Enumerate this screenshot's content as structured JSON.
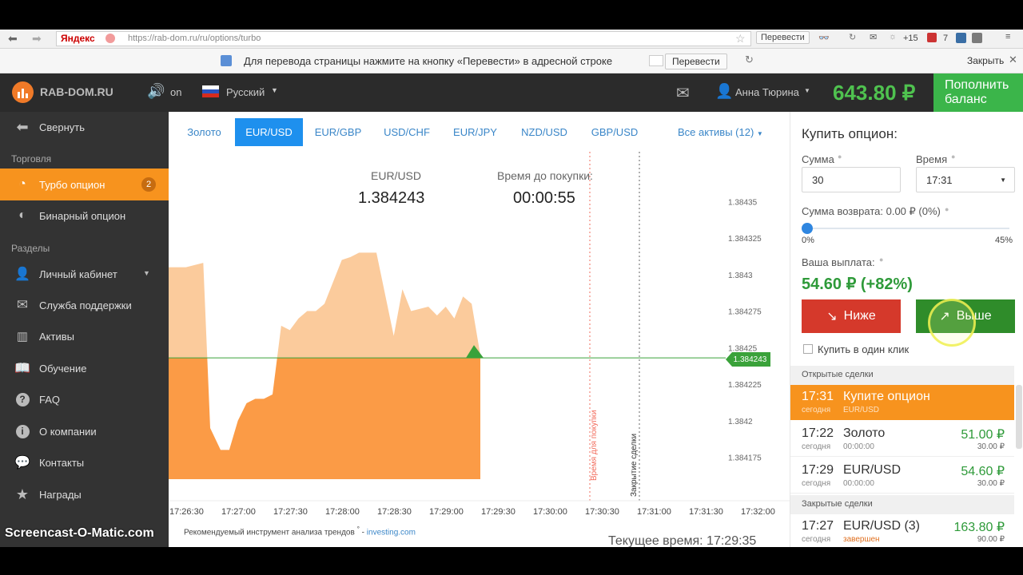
{
  "browser": {
    "yandex_logo": "Яндекс",
    "url": "https://rab-dom.ru/ru/options/turbo",
    "translate_button": "Перевести",
    "weather": "+15",
    "mail_count": "7"
  },
  "translate_bar": {
    "message": "Для перевода страницы нажмите на кнопку «Перевести» в адресной строке",
    "button": "Перевести",
    "close": "Закрыть"
  },
  "header": {
    "logo": "RAB-DOM.RU",
    "sound": "on",
    "language": "Русский",
    "user": "Анна Тюрина",
    "balance": "643.80 ₽",
    "deposit_line1": "Пополнить",
    "deposit_line2": "баланс"
  },
  "sidebar": {
    "collapse": "Свернуть",
    "section_trade": "Торговля",
    "turbo": "Турбо опцион",
    "turbo_badge": "2",
    "binary": "Бинарный опцион",
    "section_sections": "Разделы",
    "cabinet": "Личный кабинет",
    "support": "Служба поддержки",
    "assets": "Активы",
    "learning": "Обучение",
    "faq": "FAQ",
    "about": "О компании",
    "contacts": "Контакты",
    "rewards": "Награды"
  },
  "tabs": [
    "Золото",
    "EUR/USD",
    "EUR/GBP",
    "USD/CHF",
    "EUR/JPY",
    "NZD/USD",
    "GBP/USD"
  ],
  "tabs_all": "Все активы (12)",
  "chart": {
    "pair_label": "EUR/USD",
    "price": "1.384243",
    "time_label": "Время до покупки:",
    "countdown": "00:00:55",
    "current_price_tag": "1.384243",
    "y_labels": [
      "1.38435",
      "1.384325",
      "1.3843",
      "1.384275",
      "1.38425",
      "1.384225",
      "1.3842",
      "1.384175"
    ],
    "x_labels": [
      "17:26:30",
      "17:27:00",
      "17:27:30",
      "17:28:00",
      "17:28:30",
      "17:29:00",
      "17:29:30",
      "17:30:00",
      "17:30:30",
      "17:31:00",
      "17:31:30",
      "17:32:00"
    ],
    "buy_line_label": "Время для покупки",
    "close_line_label": "Закрытие сделки",
    "footnote": "Рекомендуемый инструмент анализа трендов",
    "footnote_link": "investing.com",
    "current_time_label": "Текущее время:",
    "current_time": "17:29:35",
    "colors": {
      "area_light": "#fbcb9c",
      "area_dark": "#fb9b46",
      "price_line": "#3aa23a"
    }
  },
  "chart_data": {
    "type": "area",
    "xlabel": "",
    "ylabel": "",
    "x": [
      "17:26:30",
      "17:26:40",
      "17:26:50",
      "17:26:54",
      "17:27:00",
      "17:27:05",
      "17:27:10",
      "17:27:15",
      "17:27:20",
      "17:27:25",
      "17:27:30",
      "17:27:35",
      "17:27:40",
      "17:27:45",
      "17:27:50",
      "17:27:55",
      "17:28:00",
      "17:28:10",
      "17:28:15",
      "17:28:20",
      "17:28:30",
      "17:28:40",
      "17:28:45",
      "17:28:50",
      "17:29:00",
      "17:29:05",
      "17:29:10",
      "17:29:15",
      "17:29:20",
      "17:29:25",
      "17:29:30"
    ],
    "values": [
      1.384305,
      1.384305,
      1.384308,
      1.384195,
      1.38418,
      1.38418,
      1.3842,
      1.384212,
      1.384215,
      1.384215,
      1.384218,
      1.384265,
      1.384262,
      1.38427,
      1.384275,
      1.384275,
      1.38428,
      1.38431,
      1.384312,
      1.384315,
      1.384315,
      1.384258,
      1.38429,
      1.384275,
      1.384278,
      1.384272,
      1.384278,
      1.38427,
      1.384285,
      1.38428,
      1.384245
    ],
    "ylim": [
      1.38416,
      1.38436
    ],
    "threshold": 1.384243
  },
  "right": {
    "title": "Купить опцион:",
    "sum_label": "Сумма",
    "sum_value": "30",
    "time_label": "Время",
    "time_value": "17:31",
    "return_label": "Сумма возврата: 0.00 ₽ (0%)",
    "slider_min": "0%",
    "slider_max": "45%",
    "slider_value": 0,
    "payout_label": "Ваша выплата:",
    "payout_value": "54.60 ₽ (+82%)",
    "lower": "Ниже",
    "higher": "Выше",
    "oneclick": "Купить в один клик",
    "open_deals": "Открытые сделки",
    "closed_deals": "Закрытые сделки",
    "active_deal": {
      "time": "17:31",
      "day": "сегодня",
      "title": "Купите опцион",
      "sub": "EUR/USD"
    },
    "deals": [
      {
        "time": "17:22",
        "day": "сегодня",
        "name": "Золото",
        "sub": "00:00:00",
        "amount": "51.00 ₽",
        "paid": "30.00 ₽"
      },
      {
        "time": "17:29",
        "day": "сегодня",
        "name": "EUR/USD",
        "sub": "00:00:00",
        "amount": "54.60 ₽",
        "paid": "30.00 ₽"
      }
    ],
    "closed": {
      "time": "17:27",
      "day": "сегодня",
      "name": "EUR/USD (3)",
      "sub": "завершен",
      "amount": "163.80 ₽",
      "paid": "90.00 ₽"
    }
  },
  "watermark": "Screencast-O-Matic.com"
}
